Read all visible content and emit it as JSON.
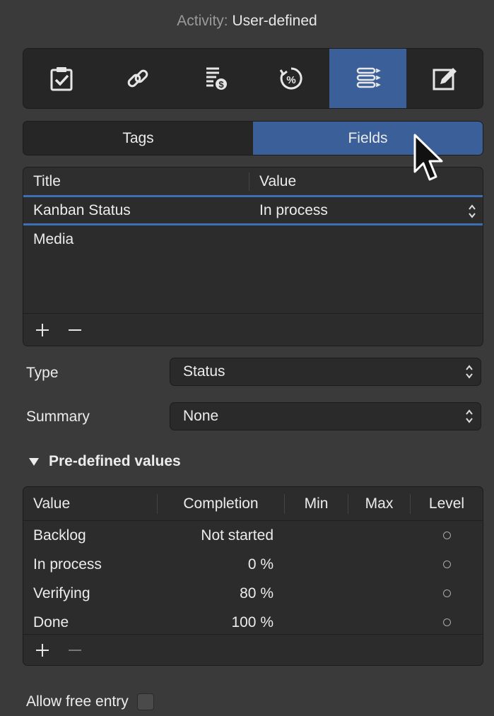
{
  "header": {
    "prefix": "Activity:",
    "value": "User-defined"
  },
  "toolbar": {
    "buttons": [
      {
        "icon": "clipboard-check-icon",
        "active": false
      },
      {
        "icon": "link-icon",
        "active": false
      },
      {
        "icon": "cost-list-icon",
        "active": false
      },
      {
        "icon": "percent-progress-icon",
        "active": false
      },
      {
        "icon": "fields-list-icon",
        "active": true
      },
      {
        "icon": "pencil-edit-icon",
        "active": false
      }
    ]
  },
  "tabs": {
    "tags": "Tags",
    "fields": "Fields",
    "selected": "Fields"
  },
  "fields_table": {
    "headers": {
      "title": "Title",
      "value": "Value"
    },
    "rows": [
      {
        "title": "Kanban Status",
        "value": "In process",
        "selected": true
      },
      {
        "title": "Media",
        "value": ""
      }
    ]
  },
  "type": {
    "label": "Type",
    "value": "Status"
  },
  "summary": {
    "label": "Summary",
    "value": "None"
  },
  "predefined": {
    "label": "Pre-defined values",
    "headers": {
      "value": "Value",
      "completion": "Completion",
      "min": "Min",
      "max": "Max",
      "level": "Level"
    },
    "rows": [
      {
        "value": "Backlog",
        "completion": "Not started",
        "min": "",
        "max": ""
      },
      {
        "value": "In process",
        "completion": "0 %",
        "min": "",
        "max": ""
      },
      {
        "value": "Verifying",
        "completion": "80 %",
        "min": "",
        "max": ""
      },
      {
        "value": "Done",
        "completion": "100 %",
        "min": "",
        "max": ""
      }
    ]
  },
  "allow_free_entry": {
    "label": "Allow free entry",
    "checked": false
  },
  "colors": {
    "accent": "#3a5f99",
    "background": "#3a3a3a"
  }
}
